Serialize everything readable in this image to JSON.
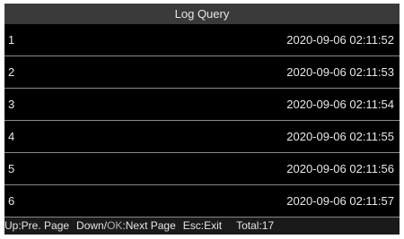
{
  "window": {
    "title": "Log Query"
  },
  "logs": [
    {
      "index": "1",
      "timestamp": "2020-09-06 02:11:52"
    },
    {
      "index": "2",
      "timestamp": "2020-09-06 02:11:53"
    },
    {
      "index": "3",
      "timestamp": "2020-09-06 02:11:54"
    },
    {
      "index": "4",
      "timestamp": "2020-09-06 02:11:55"
    },
    {
      "index": "5",
      "timestamp": "2020-09-06 02:11:56"
    },
    {
      "index": "6",
      "timestamp": "2020-09-06 02:11:57"
    }
  ],
  "status": {
    "up_hint": "Up:Pre. Page",
    "down_hint": "Down/",
    "ok_hint": "OK",
    "next_hint": ":Next Page",
    "esc_hint": "Esc:Exit",
    "total": "Total:17"
  },
  "colors": {
    "background": "#000000",
    "title_bar": "#3a3a3a",
    "row_divider": "#8a8a8a",
    "text": "#e8e8e8"
  }
}
